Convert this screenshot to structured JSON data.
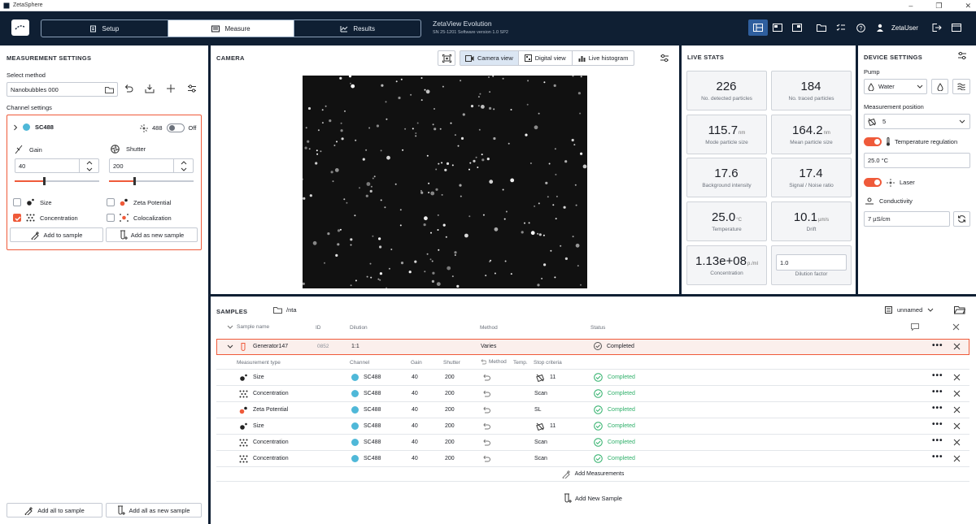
{
  "window": {
    "title": "ZetaSphere"
  },
  "nav": {
    "tabs": [
      {
        "label": "Setup"
      },
      {
        "label": "Measure"
      },
      {
        "label": "Results"
      }
    ],
    "active": "Measure"
  },
  "app": {
    "name": "ZetaView Evolution",
    "info": "SN 25-1201  Software version 1.0 SP2"
  },
  "user": {
    "name": "ZetaUser"
  },
  "measurement_settings": {
    "title": "MEASUREMENT SETTINGS",
    "select_method_label": "Select method",
    "method_value": "Nanobubbles 000",
    "channel_settings_label": "Channel settings",
    "channel": {
      "name": "SC488",
      "laser_wavelength": "488",
      "laser_state": "Off",
      "gain_label": "Gain",
      "gain_value": "40",
      "gain_level": 0.35,
      "shutter_label": "Shutter",
      "shutter_value": "200",
      "shutter_level": 0.3
    },
    "measurements": [
      {
        "label": "Size",
        "checked": false
      },
      {
        "label": "Zeta Potential",
        "checked": false
      },
      {
        "label": "Concentration",
        "checked": true
      },
      {
        "label": "Colocalization",
        "checked": false
      }
    ],
    "add_to_sample": "Add to sample",
    "add_as_new_sample": "Add as new sample",
    "add_all_to_sample": "Add all to sample",
    "add_all_as_new_sample": "Add all as new sample"
  },
  "camera": {
    "title": "CAMERA",
    "views": [
      {
        "label": "Camera view"
      },
      {
        "label": "Digital view"
      },
      {
        "label": "Live histogram"
      }
    ],
    "active_view": "Camera view"
  },
  "live_stats": {
    "title": "LIVE STATS",
    "items": [
      {
        "value": "226",
        "unit": "",
        "label": "No. detected particles"
      },
      {
        "value": "184",
        "unit": "",
        "label": "No. traced particles"
      },
      {
        "value": "115.7",
        "unit": "nm",
        "label": "Mode particle size"
      },
      {
        "value": "164.2",
        "unit": "nm",
        "label": "Mean particle size"
      },
      {
        "value": "17.6",
        "unit": "",
        "label": "Background intensity"
      },
      {
        "value": "17.4",
        "unit": "",
        "label": "Signal / Noise ratio"
      },
      {
        "value": "25.0",
        "unit": "°C",
        "label": "Temperature"
      },
      {
        "value": "10.1",
        "unit": "µm/s",
        "label": "Drift"
      },
      {
        "value": "1.13e+08",
        "unit": "p./ml",
        "label": "Concentration"
      }
    ],
    "dilution_value": "1.0",
    "dilution_label": "Dilution factor"
  },
  "device_settings": {
    "title": "DEVICE SETTINGS",
    "pump_label": "Pump",
    "pump_value": "Water",
    "position_label": "Measurement position",
    "position_value": "5",
    "temp_reg_label": "Temperature regulation",
    "temp_value": "25.0 °C",
    "laser_label": "Laser",
    "conductivity_label": "Conductivity",
    "conductivity_value": "7 µS/cm"
  },
  "samples": {
    "title": "SAMPLES",
    "path": "/nta",
    "view_name": "unnamed",
    "columns": {
      "name": "Sample name",
      "id": "ID",
      "dilution": "Dilution",
      "method": "Method",
      "status": "Status"
    },
    "sample": {
      "name": "Generator147",
      "id": "0852",
      "dilution": "1:1",
      "method": "Varies",
      "status": "Completed"
    },
    "sub_columns": {
      "type": "Measurement type",
      "channel": "Channel",
      "gain": "Gain",
      "shutter": "Shutter",
      "method": "Method",
      "temp": "Temp.",
      "stop": "Stop criteria"
    },
    "rows": [
      {
        "type": "Size",
        "channel": "SC488",
        "gain": "40",
        "shutter": "200",
        "stop": "11",
        "status": "Completed",
        "icon": "size-icon"
      },
      {
        "type": "Concentration",
        "channel": "SC488",
        "gain": "40",
        "shutter": "200",
        "stop": "Scan",
        "status": "Completed",
        "icon": "concentration-icon"
      },
      {
        "type": "Zeta Potential",
        "channel": "SC488",
        "gain": "40",
        "shutter": "200",
        "stop": "SL",
        "status": "Completed",
        "icon": "zeta-icon"
      },
      {
        "type": "Size",
        "channel": "SC488",
        "gain": "40",
        "shutter": "200",
        "stop": "11",
        "status": "Completed",
        "icon": "size-icon"
      },
      {
        "type": "Concentration",
        "channel": "SC488",
        "gain": "40",
        "shutter": "200",
        "stop": "Scan",
        "status": "Completed",
        "icon": "concentration-icon"
      },
      {
        "type": "Concentration",
        "channel": "SC488",
        "gain": "40",
        "shutter": "200",
        "stop": "Scan",
        "status": "Completed",
        "icon": "concentration-icon"
      }
    ],
    "add_measurements": "Add Measurements",
    "add_new_sample": "Add New Sample"
  },
  "colors": {
    "header": "#0f1f33",
    "accent": "#ef5a3a",
    "channel": "#4fb8d8",
    "success": "#2fb06a"
  }
}
